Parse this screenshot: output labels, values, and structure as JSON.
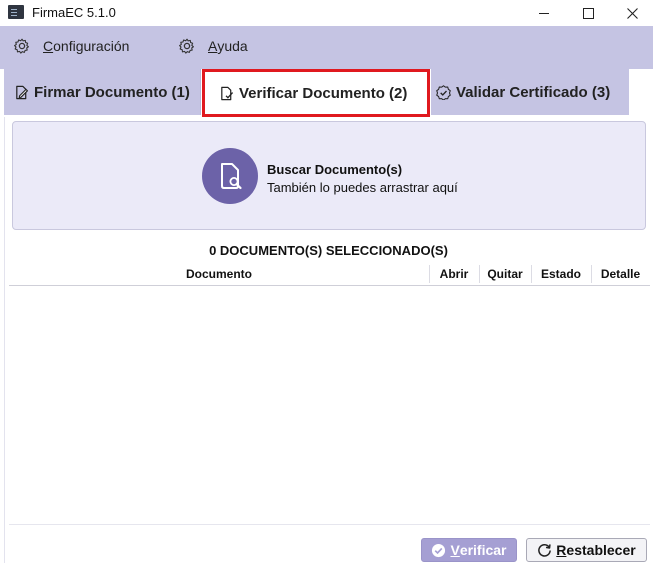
{
  "window": {
    "title": "FirmaEC 5.1.0"
  },
  "menu": {
    "config_first": "C",
    "config_rest": "onfiguración",
    "ayuda_first": "A",
    "ayuda_rest": "yuda"
  },
  "tabs": [
    {
      "label": "Firmar Documento (1)",
      "icon": "sign-doc-icon"
    },
    {
      "label": "Verificar Documento (2)",
      "icon": "verify-doc-icon",
      "selected": true,
      "highlight_color": "#e0191f"
    },
    {
      "label": "Validar Certificado (3)",
      "icon": "badge-check-icon"
    }
  ],
  "dropzone": {
    "title": "Buscar Documento(s)",
    "subtitle": "También lo puedes arrastrar aquí",
    "icon": "search-document-icon"
  },
  "selection_count": "0 DOCUMENTO(S) SELECCIONADO(S)",
  "table": {
    "columns": [
      "Documento",
      "Abrir",
      "Quitar",
      "Estado",
      "Detalle"
    ],
    "rows": []
  },
  "buttons": {
    "verificar_first": "V",
    "verificar_rest": "erificar",
    "restablecer_first": "R",
    "restablecer_rest": "establecer"
  },
  "colors": {
    "accent": "#6c62a8",
    "menubar_bg": "#c5c4e3",
    "dropzone_bg": "#ebeaf8",
    "primary_button": "#a59fd3"
  }
}
